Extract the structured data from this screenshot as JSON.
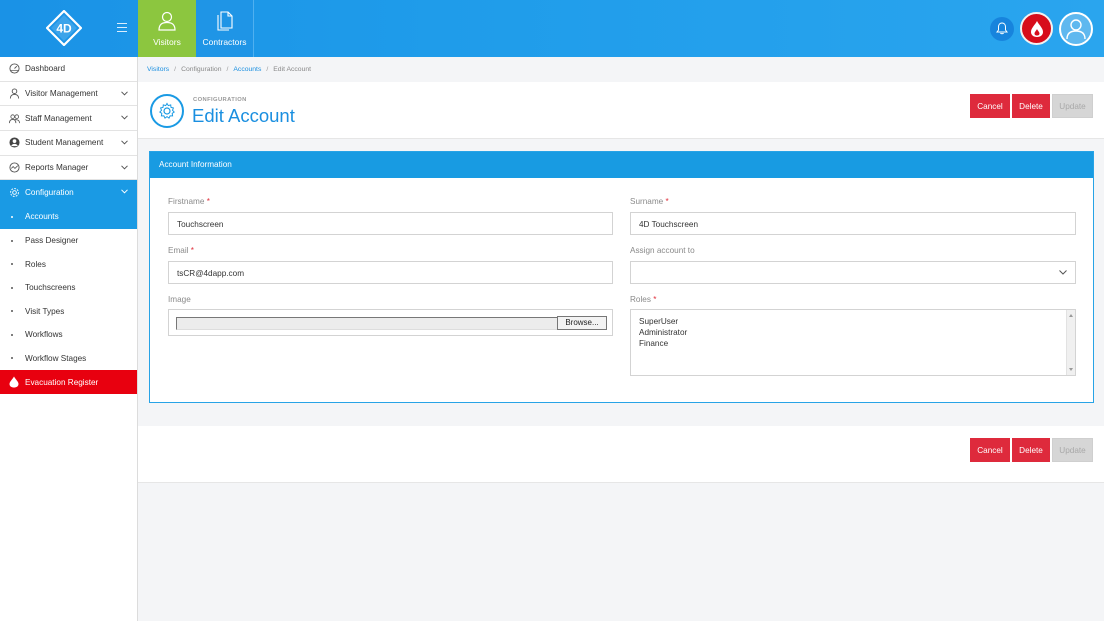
{
  "topbar": {
    "logo_text": "4D",
    "tabs": [
      {
        "label": "Visitors",
        "icon": "person-icon",
        "active": true
      },
      {
        "label": "Contractors",
        "icon": "document-icon",
        "active": false
      }
    ],
    "icons": [
      "bell-icon",
      "evacuation-drop-icon",
      "user-avatar-icon"
    ]
  },
  "sidebar": {
    "items": [
      {
        "label": "Dashboard",
        "icon": "dashboard-icon"
      },
      {
        "label": "Visitor Management",
        "icon": "person-icon"
      },
      {
        "label": "Staff Management",
        "icon": "staff-icon"
      },
      {
        "label": "Student Management",
        "icon": "student-icon"
      },
      {
        "label": "Reports Manager",
        "icon": "chart-icon"
      },
      {
        "label": "Configuration",
        "icon": "gear-icon"
      }
    ],
    "sub_items": [
      "Accounts",
      "Pass Designer",
      "Roles",
      "Touchscreens",
      "Visit Types",
      "Workflows",
      "Workflow Stages"
    ],
    "evacuation": "Evacuation Register"
  },
  "breadcrumb": [
    "Visitors",
    "Configuration",
    "Accounts",
    "Edit Account"
  ],
  "header": {
    "kicker": "CONFIGURATION",
    "title": "Edit Account"
  },
  "actions": {
    "cancel": "Cancel",
    "delete": "Delete",
    "update": "Update"
  },
  "form": {
    "card_title": "Account Information",
    "firstname": {
      "label": "Firstname",
      "value": "Touchscreen"
    },
    "surname": {
      "label": "Surname",
      "value": "4D Touchscreen"
    },
    "email": {
      "label": "Email",
      "value": "tsCR@4dapp.com"
    },
    "assign": {
      "label": "Assign account to",
      "value": ""
    },
    "image": {
      "label": "Image",
      "browse": "Browse..."
    },
    "roles": {
      "label": "Roles",
      "options": [
        "SuperUser",
        "Administrator",
        "Finance"
      ]
    },
    "required_mark": "*"
  },
  "colors": {
    "brand_blue": "#1a9ae4",
    "active_green": "#8cc63f",
    "danger_red": "#de2a3c",
    "evac_red": "#e8000f"
  }
}
